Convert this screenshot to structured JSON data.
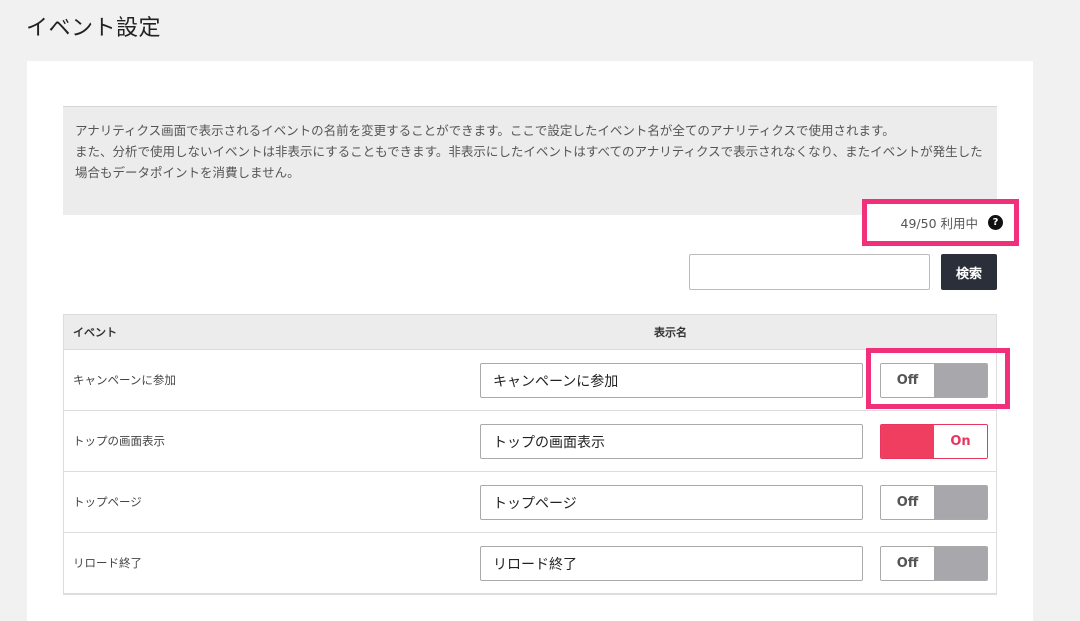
{
  "page": {
    "title": "イベント設定"
  },
  "description": {
    "line1": "アナリティクス画面で表示されるイベントの名前を変更することができます。ここで設定したイベント名が全てのアナリティクスで使用されます。",
    "line2": "また、分析で使用しないイベントは非表示にすることもできます。非表示にしたイベントはすべてのアナリティクスで表示されなくなり、またイベントが発生した場合もデータポイントを消費しません。"
  },
  "usage": {
    "text": "49/50 利用中",
    "icon": "?"
  },
  "search": {
    "value": "",
    "placeholder": "",
    "button_label": "検索"
  },
  "table": {
    "headers": {
      "event": "イベント",
      "display_name": "表示名"
    },
    "rows": [
      {
        "event": "キャンペーンに参加",
        "display_name": "キャンペーンに参加",
        "toggle": "Off"
      },
      {
        "event": "トップの画面表示",
        "display_name": "トップの画面表示",
        "toggle": "On"
      },
      {
        "event": "トップページ",
        "display_name": "トップページ",
        "toggle": "Off"
      },
      {
        "event": "リロード終了",
        "display_name": "リロード終了",
        "toggle": "Off"
      }
    ]
  },
  "colors": {
    "highlight": "#f0307a",
    "toggle_on": "#f03e60",
    "toggle_off": "#a8a8ac",
    "search_button": "#2b2f3a"
  }
}
